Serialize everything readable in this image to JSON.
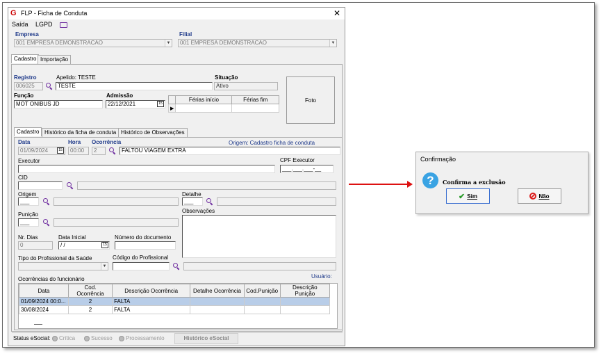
{
  "window": {
    "title": "FLP - Ficha de Conduta",
    "close_label": "✕",
    "logo_label": "G"
  },
  "menu": {
    "saida": "Saída",
    "lgpd": "LGPD"
  },
  "empresa": {
    "label": "Empresa",
    "value": "001 EMPRESA DEMONSTRACAO"
  },
  "filial": {
    "label": "Filial",
    "value": "001 EMPRESA DEMONSTRACAO"
  },
  "top_tabs": [
    "Cadastro",
    "Importação"
  ],
  "registro": {
    "label": "Registro",
    "value": "006025",
    "apelido_label": "Apelido: TESTE",
    "nome": "TESTE"
  },
  "situacao": {
    "label": "Situação",
    "value": "Ativo"
  },
  "funcao": {
    "label": "Função",
    "value": "MOT ONIBUS JD"
  },
  "admissao": {
    "label": "Admissão",
    "value": "22/12/2021"
  },
  "ferias": {
    "col1": "Férias início",
    "col2": "Férias fim"
  },
  "foto_label": "Foto",
  "inner_tabs": [
    "Cadastro",
    "Histórico da ficha de conduta",
    "Histórico de Observações"
  ],
  "ocorr": {
    "data_label": "Data",
    "data_value": "01/09/2024",
    "hora_label": "Hora",
    "hora_value": "00:00",
    "ocorrencia_label": "Ocorrência",
    "ocorrencia_code": "2",
    "ocorrencia_desc": "FALTOU VIAGEM EXTRA",
    "origem_info": "Origem: Cadastro ficha de conduta"
  },
  "executor_label": "Executor",
  "cpf_label": "CPF Executor",
  "cpf_value": "___.___.___-__",
  "cid_label": "CID",
  "origem_label": "Origem",
  "origem_value": "___",
  "detalhe_label": "Detalhe",
  "detalhe_value": "___",
  "punicao_label": "Punição",
  "punicao_value": "___",
  "observacoes_label": "Observações",
  "nr_dias": {
    "label": "Nr. Dias",
    "value": "0"
  },
  "data_inicial": {
    "label": "Data Inicial",
    "value": "/ /"
  },
  "num_doc_label": "Número do documento",
  "tipo_prof_label": "Tipo do Profissional da Saúde",
  "cod_prof_label": "Código do Profissional",
  "ocorrencias_label": "Ocorrências do funcionário",
  "usuario_label": "Usuário:",
  "table": {
    "headers": [
      "Data",
      "Cod. Ocorrência",
      "Descrição Ocorrência",
      "Detalhe Ocorrência",
      "Cod.Punição",
      "Descrição Punição"
    ],
    "rows": [
      [
        "01/09/2024 00:0...",
        "2",
        "FALTA",
        "",
        "",
        ""
      ],
      [
        "30/08/2024",
        "2",
        "FALTA",
        "",
        "",
        ""
      ]
    ]
  },
  "status": {
    "label": "Status eSocial:",
    "critica": "Crítica",
    "sucesso": "Sucesso",
    "processamento": "Processamento",
    "historico_button": "Histórico eSocial"
  },
  "dialog": {
    "title": "Confirmação",
    "icon": "question-icon",
    "message": "Confirma a exclusão",
    "sim": "Sim",
    "nao": "Não"
  }
}
